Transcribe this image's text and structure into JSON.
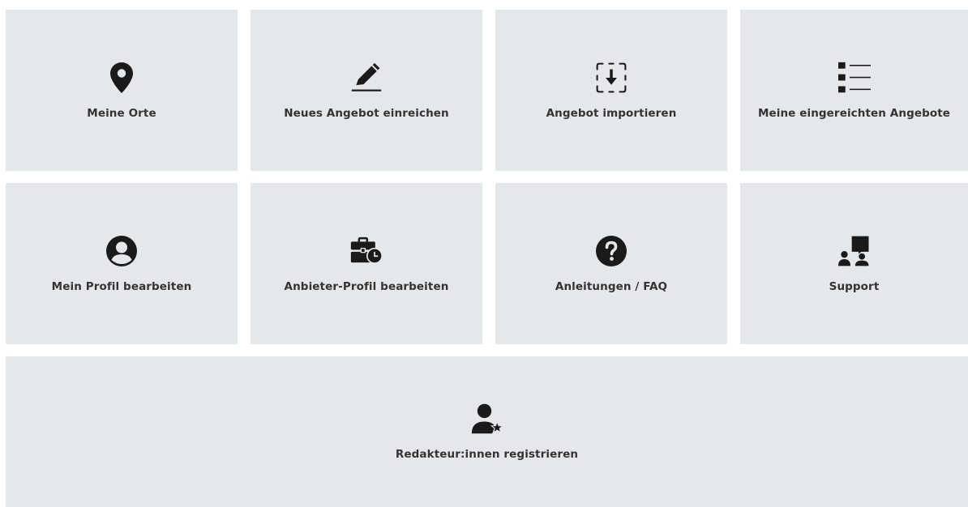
{
  "tiles": [
    {
      "label": "Meine Orte",
      "icon": "map-pin-icon"
    },
    {
      "label": "Neues Angebot einreichen",
      "icon": "pencil-icon"
    },
    {
      "label": "Angebot importieren",
      "icon": "import-icon"
    },
    {
      "label": "Meine eingereichten Angebote",
      "icon": "list-icon"
    },
    {
      "label": "Mein Profil bearbeiten",
      "icon": "user-circle-icon"
    },
    {
      "label": "Anbieter-Profil bearbeiten",
      "icon": "briefcase-clock-icon"
    },
    {
      "label": "Anleitungen / FAQ",
      "icon": "question-circle-icon"
    },
    {
      "label": "Support",
      "icon": "support-chat-icon"
    },
    {
      "label": "Redakteur:innen registrieren",
      "icon": "user-star-icon"
    }
  ],
  "colors": {
    "tile_background": "#e5e8eb",
    "icon": "#1a1a1a",
    "label": "#333333"
  }
}
